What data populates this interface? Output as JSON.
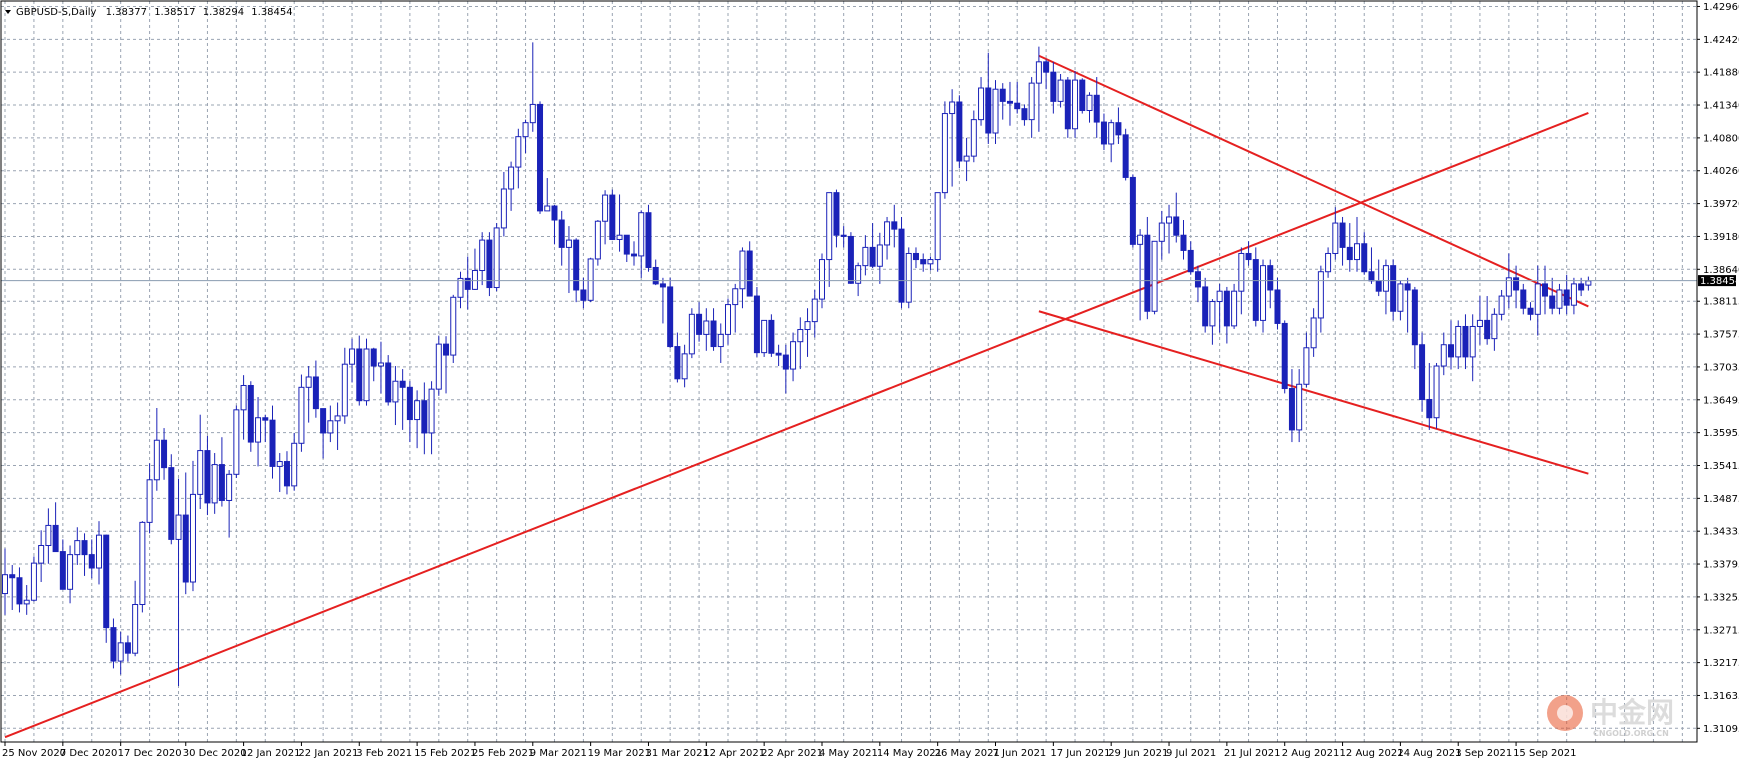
{
  "chart_data": {
    "type": "candlestick",
    "symbol_label": "GBPUSD-S,Daily",
    "ohlc_readout": [
      "1.38377",
      "1.38517",
      "1.38294",
      "1.38454"
    ],
    "current_price_label": "1.38454",
    "current_price": 1.38454,
    "y_ticks": [
      "1.42960",
      "1.42420",
      "1.41880",
      "1.41340",
      "1.40800",
      "1.40260",
      "1.39720",
      "1.39180",
      "1.38640",
      "1.38115",
      "1.37575",
      "1.37035",
      "1.36495",
      "1.35955",
      "1.35415",
      "1.34875",
      "1.34335",
      "1.33795",
      "1.33255",
      "1.32715",
      "1.32175",
      "1.31635",
      "1.31095"
    ],
    "x_ticks": [
      "25 Nov 2020",
      "7 Dec 2020",
      "17 Dec 2020",
      "30 Dec 2020",
      "12 Jan 2021",
      "22 Jan 2021",
      "3 Feb 2021",
      "15 Feb 2021",
      "25 Feb 2021",
      "9 Mar 2021",
      "19 Mar 2021",
      "31 Mar 2021",
      "12 Apr 2021",
      "22 Apr 2021",
      "4 May 2021",
      "14 May 2021",
      "26 May 2021",
      "7 Jun 2021",
      "17 Jun 2021",
      "29 Jun 2021",
      "9 Jul 2021",
      "21 Jul 2021",
      "2 Aug 2021",
      "12 Aug 2021",
      "24 Aug 2021",
      "3 Sep 2021",
      "15 Sep 2021"
    ],
    "x_tick_bar_index": [
      0,
      8,
      16,
      25,
      33,
      41,
      49,
      57,
      65,
      73,
      81,
      89,
      97,
      105,
      113,
      121,
      129,
      137,
      145,
      153,
      161,
      169,
      177,
      185,
      193,
      201,
      209
    ],
    "ylim": [
      1.3087,
      1.4305
    ],
    "grid": true,
    "colors": {
      "background": "#ffffff",
      "grid": "#9aa4b2",
      "bull": "#1a22b8",
      "bear": "#1a22b8",
      "trendline": "#e52020",
      "price_line": "#8a9bb0",
      "label_bg": "#000000"
    },
    "candles": [
      [
        1.3331,
        1.3405,
        1.3296,
        1.3362
      ],
      [
        1.3362,
        1.3378,
        1.3304,
        1.3357
      ],
      [
        1.3357,
        1.3374,
        1.33,
        1.3314
      ],
      [
        1.3314,
        1.3345,
        1.3296,
        1.332
      ],
      [
        1.332,
        1.3392,
        1.3318,
        1.3381
      ],
      [
        1.3381,
        1.3435,
        1.335,
        1.341
      ],
      [
        1.341,
        1.3471,
        1.338,
        1.3443
      ],
      [
        1.3443,
        1.3481,
        1.34,
        1.34
      ],
      [
        1.34,
        1.342,
        1.3338,
        1.3338
      ],
      [
        1.3338,
        1.341,
        1.3315,
        1.3395
      ],
      [
        1.3395,
        1.344,
        1.3378,
        1.3418
      ],
      [
        1.3418,
        1.343,
        1.336,
        1.3395
      ],
      [
        1.3395,
        1.342,
        1.3356,
        1.3373
      ],
      [
        1.3373,
        1.345,
        1.3346,
        1.3427
      ],
      [
        1.3427,
        1.3428,
        1.325,
        1.3275
      ],
      [
        1.3275,
        1.329,
        1.3208,
        1.322
      ],
      [
        1.322,
        1.3268,
        1.3198,
        1.325
      ],
      [
        1.325,
        1.3262,
        1.3219,
        1.3233
      ],
      [
        1.3233,
        1.3352,
        1.3228,
        1.3313
      ],
      [
        1.3313,
        1.345,
        1.33,
        1.3448
      ],
      [
        1.3448,
        1.3545,
        1.343,
        1.3518
      ],
      [
        1.3518,
        1.3636,
        1.35,
        1.3583
      ],
      [
        1.3583,
        1.3603,
        1.3518,
        1.3538
      ],
      [
        1.3538,
        1.356,
        1.3412,
        1.342
      ],
      [
        1.342,
        1.352,
        1.3179,
        1.346
      ],
      [
        1.346,
        1.353,
        1.333,
        1.335
      ],
      [
        1.335,
        1.3549,
        1.3335,
        1.3494
      ],
      [
        1.3494,
        1.3625,
        1.347,
        1.3566
      ],
      [
        1.3566,
        1.359,
        1.346,
        1.348
      ],
      [
        1.348,
        1.3562,
        1.3462,
        1.3543
      ],
      [
        1.3543,
        1.3588,
        1.3474,
        1.3484
      ],
      [
        1.3484,
        1.3534,
        1.3423,
        1.3527
      ],
      [
        1.3527,
        1.364,
        1.3521,
        1.3633
      ],
      [
        1.3633,
        1.369,
        1.3584,
        1.3673
      ],
      [
        1.3673,
        1.368,
        1.3564,
        1.358
      ],
      [
        1.358,
        1.3654,
        1.354,
        1.362
      ],
      [
        1.362,
        1.3625,
        1.358,
        1.3616
      ],
      [
        1.3616,
        1.364,
        1.352,
        1.354
      ],
      [
        1.354,
        1.3562,
        1.3498,
        1.3548
      ],
      [
        1.3548,
        1.3565,
        1.3494,
        1.3508
      ],
      [
        1.3508,
        1.3595,
        1.35,
        1.3578
      ],
      [
        1.3578,
        1.3691,
        1.3564,
        1.367
      ],
      [
        1.367,
        1.3705,
        1.3612,
        1.3687
      ],
      [
        1.3687,
        1.3714,
        1.362,
        1.3635
      ],
      [
        1.3635,
        1.3595,
        1.3553,
        1.3595
      ],
      [
        1.3595,
        1.364,
        1.358,
        1.3615
      ],
      [
        1.3615,
        1.3645,
        1.3567,
        1.3623
      ],
      [
        1.3623,
        1.3735,
        1.361,
        1.3708
      ],
      [
        1.3708,
        1.375,
        1.3678,
        1.3733
      ],
      [
        1.3733,
        1.3755,
        1.364,
        1.3648
      ],
      [
        1.3648,
        1.375,
        1.364,
        1.3733
      ],
      [
        1.3733,
        1.3735,
        1.368,
        1.3705
      ],
      [
        1.3705,
        1.3745,
        1.366,
        1.371
      ],
      [
        1.371,
        1.3723,
        1.364,
        1.3646
      ],
      [
        1.3646,
        1.3705,
        1.3608,
        1.368
      ],
      [
        1.368,
        1.37,
        1.36,
        1.367
      ],
      [
        1.367,
        1.368,
        1.358,
        1.3617
      ],
      [
        1.3617,
        1.3665,
        1.357,
        1.3648
      ],
      [
        1.3648,
        1.3678,
        1.356,
        1.3595
      ],
      [
        1.3595,
        1.368,
        1.356,
        1.3667
      ],
      [
        1.3667,
        1.3755,
        1.3656,
        1.3741
      ],
      [
        1.3741,
        1.3754,
        1.366,
        1.3723
      ],
      [
        1.3723,
        1.3822,
        1.371,
        1.3818
      ],
      [
        1.3818,
        1.386,
        1.38,
        1.3849
      ],
      [
        1.3849,
        1.3885,
        1.3798,
        1.3831
      ],
      [
        1.3831,
        1.3898,
        1.383,
        1.3862
      ],
      [
        1.3862,
        1.3925,
        1.3838,
        1.3912
      ],
      [
        1.3912,
        1.3925,
        1.382,
        1.3834
      ],
      [
        1.3834,
        1.394,
        1.3828,
        1.3932
      ],
      [
        1.3932,
        1.4024,
        1.3918,
        1.3996
      ],
      [
        1.3996,
        1.4041,
        1.396,
        1.4032
      ],
      [
        1.4032,
        1.4095,
        1.3997,
        1.4082
      ],
      [
        1.4082,
        1.411,
        1.4055,
        1.4105
      ],
      [
        1.4105,
        1.4237,
        1.409,
        1.4135
      ],
      [
        1.4135,
        1.414,
        1.3955,
        1.396
      ],
      [
        1.396,
        1.4014,
        1.396,
        1.3968
      ],
      [
        1.3968,
        1.397,
        1.3905,
        1.3945
      ],
      [
        1.3945,
        1.396,
        1.387,
        1.39
      ],
      [
        1.39,
        1.3935,
        1.3825,
        1.3912
      ],
      [
        1.3912,
        1.3915,
        1.381,
        1.383
      ],
      [
        1.383,
        1.385,
        1.38,
        1.3813
      ],
      [
        1.3813,
        1.3883,
        1.381,
        1.3881
      ],
      [
        1.3881,
        1.3945,
        1.387,
        1.3943
      ],
      [
        1.3943,
        1.3994,
        1.3905,
        1.3986
      ],
      [
        1.3986,
        1.3995,
        1.3912,
        1.3913
      ],
      [
        1.3913,
        1.3987,
        1.3893,
        1.392
      ],
      [
        1.392,
        1.392,
        1.3876,
        1.3889
      ],
      [
        1.3889,
        1.391,
        1.387,
        1.3886
      ],
      [
        1.3886,
        1.3961,
        1.385,
        1.3957
      ],
      [
        1.3957,
        1.397,
        1.386,
        1.3867
      ],
      [
        1.3867,
        1.388,
        1.3838,
        1.384
      ],
      [
        1.384,
        1.385,
        1.3775,
        1.3835
      ],
      [
        1.3835,
        1.385,
        1.3734,
        1.3737
      ],
      [
        1.3737,
        1.376,
        1.3678,
        1.3684
      ],
      [
        1.3684,
        1.374,
        1.367,
        1.3725
      ],
      [
        1.3725,
        1.38,
        1.3718,
        1.379
      ],
      [
        1.379,
        1.381,
        1.3745,
        1.3757
      ],
      [
        1.3757,
        1.38,
        1.373,
        1.3779
      ],
      [
        1.3779,
        1.38,
        1.373,
        1.3737
      ],
      [
        1.3737,
        1.3775,
        1.371,
        1.3757
      ],
      [
        1.3757,
        1.3816,
        1.374,
        1.3806
      ],
      [
        1.3806,
        1.384,
        1.376,
        1.3832
      ],
      [
        1.3832,
        1.39,
        1.38,
        1.3894
      ],
      [
        1.3894,
        1.391,
        1.382,
        1.382
      ],
      [
        1.382,
        1.3835,
        1.372,
        1.3727
      ],
      [
        1.3727,
        1.378,
        1.372,
        1.378
      ],
      [
        1.378,
        1.379,
        1.372,
        1.3726
      ],
      [
        1.3726,
        1.374,
        1.3705,
        1.3723
      ],
      [
        1.3723,
        1.374,
        1.366,
        1.37
      ],
      [
        1.37,
        1.376,
        1.368,
        1.3745
      ],
      [
        1.3745,
        1.3785,
        1.37,
        1.3765
      ],
      [
        1.3765,
        1.38,
        1.372,
        1.3778
      ],
      [
        1.3778,
        1.383,
        1.3752,
        1.3815
      ],
      [
        1.3815,
        1.389,
        1.38,
        1.388
      ],
      [
        1.388,
        1.399,
        1.3835,
        1.399
      ],
      [
        1.399,
        1.3995,
        1.39,
        1.392
      ],
      [
        1.392,
        1.3935,
        1.39,
        1.3918
      ],
      [
        1.3918,
        1.3925,
        1.384,
        1.3841
      ],
      [
        1.3841,
        1.3875,
        1.382,
        1.387
      ],
      [
        1.387,
        1.392,
        1.3854,
        1.39
      ],
      [
        1.39,
        1.394,
        1.3866,
        1.3869
      ],
      [
        1.3869,
        1.3924,
        1.384,
        1.3904
      ],
      [
        1.3904,
        1.395,
        1.388,
        1.3942
      ],
      [
        1.3942,
        1.397,
        1.39,
        1.393
      ],
      [
        1.393,
        1.395,
        1.38,
        1.381
      ],
      [
        1.381,
        1.39,
        1.38,
        1.389
      ],
      [
        1.389,
        1.39,
        1.3866,
        1.388
      ],
      [
        1.388,
        1.389,
        1.386,
        1.3873
      ],
      [
        1.3873,
        1.3885,
        1.3862,
        1.388
      ],
      [
        1.388,
        1.399,
        1.386,
        1.399
      ],
      [
        1.399,
        1.414,
        1.398,
        1.412
      ],
      [
        1.412,
        1.416,
        1.4,
        1.4139
      ],
      [
        1.4139,
        1.415,
        1.403,
        1.4042
      ],
      [
        1.4042,
        1.408,
        1.4009,
        1.405
      ],
      [
        1.405,
        1.4125,
        1.404,
        1.411
      ],
      [
        1.411,
        1.418,
        1.41,
        1.4162
      ],
      [
        1.4162,
        1.422,
        1.407,
        1.4088
      ],
      [
        1.4088,
        1.4175,
        1.407,
        1.416
      ],
      [
        1.416,
        1.417,
        1.411,
        1.414
      ],
      [
        1.414,
        1.4172,
        1.41,
        1.4137
      ],
      [
        1.4137,
        1.4172,
        1.412,
        1.4128
      ],
      [
        1.4128,
        1.4135,
        1.41,
        1.411
      ],
      [
        1.411,
        1.418,
        1.408,
        1.417
      ],
      [
        1.417,
        1.423,
        1.409,
        1.4205
      ],
      [
        1.4205,
        1.4209,
        1.416,
        1.4188
      ],
      [
        1.4188,
        1.4205,
        1.412,
        1.414
      ],
      [
        1.414,
        1.4185,
        1.413,
        1.4175
      ],
      [
        1.4175,
        1.418,
        1.408,
        1.4095
      ],
      [
        1.4095,
        1.419,
        1.408,
        1.4175
      ],
      [
        1.4175,
        1.4178,
        1.412,
        1.4125
      ],
      [
        1.4125,
        1.4155,
        1.4105,
        1.415
      ],
      [
        1.415,
        1.418,
        1.408,
        1.4106
      ],
      [
        1.4106,
        1.412,
        1.406,
        1.407
      ],
      [
        1.407,
        1.411,
        1.404,
        1.4105
      ],
      [
        1.4105,
        1.413,
        1.407,
        1.4085
      ],
      [
        1.4085,
        1.4095,
        1.401,
        1.4015
      ],
      [
        1.4015,
        1.402,
        1.39,
        1.3905
      ],
      [
        1.3905,
        1.393,
        1.378,
        1.392
      ],
      [
        1.392,
        1.395,
        1.3782,
        1.3795
      ],
      [
        1.3795,
        1.39,
        1.379,
        1.391
      ],
      [
        1.391,
        1.396,
        1.388,
        1.394
      ],
      [
        1.394,
        1.397,
        1.389,
        1.395
      ],
      [
        1.395,
        1.399,
        1.3908,
        1.392
      ],
      [
        1.392,
        1.3945,
        1.388,
        1.3895
      ],
      [
        1.3895,
        1.391,
        1.3855,
        1.386
      ],
      [
        1.386,
        1.387,
        1.381,
        1.3835
      ],
      [
        1.3835,
        1.385,
        1.376,
        1.3771
      ],
      [
        1.3771,
        1.3815,
        1.374,
        1.3811
      ],
      [
        1.3811,
        1.384,
        1.376,
        1.3828
      ],
      [
        1.3828,
        1.3835,
        1.3742,
        1.3771
      ],
      [
        1.3771,
        1.384,
        1.3766,
        1.3828
      ],
      [
        1.3828,
        1.39,
        1.379,
        1.389
      ],
      [
        1.389,
        1.391,
        1.387,
        1.388
      ],
      [
        1.388,
        1.39,
        1.377,
        1.378
      ],
      [
        1.378,
        1.388,
        1.376,
        1.387
      ],
      [
        1.387,
        1.388,
        1.38,
        1.383
      ],
      [
        1.383,
        1.385,
        1.3765,
        1.3775
      ],
      [
        1.3775,
        1.378,
        1.366,
        1.3668
      ],
      [
        1.3668,
        1.37,
        1.358,
        1.36
      ],
      [
        1.36,
        1.37,
        1.358,
        1.3675
      ],
      [
        1.3675,
        1.376,
        1.367,
        1.3735
      ],
      [
        1.3735,
        1.38,
        1.372,
        1.3784
      ],
      [
        1.3784,
        1.387,
        1.376,
        1.386
      ],
      [
        1.386,
        1.39,
        1.385,
        1.389
      ],
      [
        1.389,
        1.3966,
        1.388,
        1.394
      ],
      [
        1.394,
        1.395,
        1.387,
        1.39
      ],
      [
        1.39,
        1.394,
        1.386,
        1.388
      ],
      [
        1.388,
        1.395,
        1.386,
        1.3906
      ],
      [
        1.3906,
        1.3925,
        1.3855,
        1.386
      ],
      [
        1.386,
        1.39,
        1.384,
        1.3845
      ],
      [
        1.3845,
        1.388,
        1.382,
        1.3828
      ],
      [
        1.3828,
        1.388,
        1.379,
        1.387
      ],
      [
        1.387,
        1.388,
        1.378,
        1.3795
      ],
      [
        1.3795,
        1.3845,
        1.378,
        1.384
      ],
      [
        1.384,
        1.385,
        1.376,
        1.383
      ],
      [
        1.383,
        1.3835,
        1.37,
        1.374
      ],
      [
        1.374,
        1.376,
        1.363,
        1.365
      ],
      [
        1.365,
        1.371,
        1.36,
        1.362
      ],
      [
        1.362,
        1.371,
        1.3602,
        1.3705
      ],
      [
        1.3705,
        1.376,
        1.369,
        1.374
      ],
      [
        1.374,
        1.378,
        1.37,
        1.372
      ],
      [
        1.372,
        1.378,
        1.37,
        1.377
      ],
      [
        1.377,
        1.379,
        1.37,
        1.372
      ],
      [
        1.372,
        1.379,
        1.368,
        1.377
      ],
      [
        1.377,
        1.382,
        1.374,
        1.378
      ],
      [
        1.378,
        1.382,
        1.374,
        1.375
      ],
      [
        1.375,
        1.38,
        1.373,
        1.379
      ],
      [
        1.379,
        1.383,
        1.378,
        1.382
      ],
      [
        1.382,
        1.389,
        1.38,
        1.385
      ],
      [
        1.385,
        1.387,
        1.38,
        1.383
      ],
      [
        1.383,
        1.384,
        1.379,
        1.38
      ],
      [
        1.38,
        1.381,
        1.378,
        1.379
      ],
      [
        1.379,
        1.387,
        1.3755,
        1.384
      ],
      [
        1.384,
        1.387,
        1.379,
        1.382
      ],
      [
        1.382,
        1.385,
        1.379,
        1.38
      ],
      [
        1.38,
        1.384,
        1.379,
        1.383
      ],
      [
        1.383,
        1.3855,
        1.379,
        1.3805
      ],
      [
        1.3805,
        1.385,
        1.379,
        1.384
      ],
      [
        1.384,
        1.385,
        1.382,
        1.383
      ],
      [
        1.3838,
        1.3852,
        1.3829,
        1.3845
      ]
    ],
    "trendlines": [
      {
        "name": "",
        "from": {
          "bar": 0,
          "price": 1.3095
        },
        "to": {
          "bar": 219,
          "price": 1.4121
        }
      },
      {
        "name": "",
        "from": {
          "bar": 143,
          "price": 1.4215
        },
        "to": {
          "bar": 219,
          "price": 1.3803
        }
      },
      {
        "name": "",
        "from": {
          "bar": 143,
          "price": 1.3795
        },
        "to": {
          "bar": 219,
          "price": 1.3528
        }
      }
    ]
  },
  "watermark": {
    "brand_text": "中金网",
    "url_text": "CNGOLD.ORG.CN",
    "logo_color": "#e8542a"
  }
}
